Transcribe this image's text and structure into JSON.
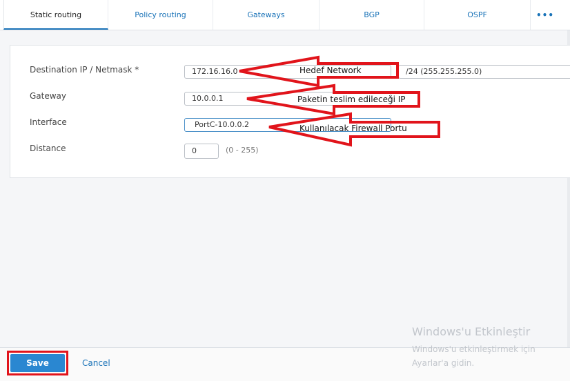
{
  "tabs": [
    {
      "label": "Static routing",
      "active": true
    },
    {
      "label": "Policy routing"
    },
    {
      "label": "Gateways"
    },
    {
      "label": "BGP"
    },
    {
      "label": "OSPF"
    }
  ],
  "more_label": "•••",
  "form": {
    "destination": {
      "label": "Destination IP / Netmask *",
      "ip": "172.16.16.0",
      "netmask": "/24 (255.255.255.0)"
    },
    "gateway": {
      "label": "Gateway",
      "value": "10.0.0.1"
    },
    "interface": {
      "label": "Interface",
      "value": "PortC-10.0.0.2"
    },
    "distance": {
      "label": "Distance",
      "value": "0",
      "range": "(0 - 255)"
    }
  },
  "annotations": {
    "destination": "Hedef Network",
    "gateway": "Paketin teslim edileceği IP",
    "interface": "Kullanılacak Firewall Portu",
    "color": "#e1141b"
  },
  "footer": {
    "save_label": "Save",
    "cancel_label": "Cancel"
  },
  "watermark": {
    "title": "Windows'u Etkinleştir",
    "line1": "Windows'u etkinleştirmek için",
    "line2": "Ayarlar'a gidin."
  },
  "colors": {
    "accent": "#1a73b8",
    "save": "#2a87d1",
    "highlight": "#e1141b"
  }
}
